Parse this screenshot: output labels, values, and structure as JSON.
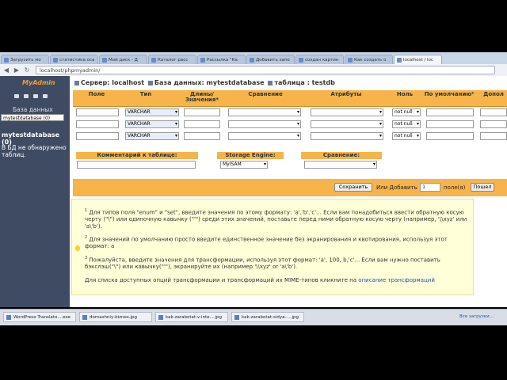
{
  "browser": {
    "tabs": [
      "Загрузить мо",
      "статистика оса",
      "Мой диск - Д",
      "Каталог расс",
      "Рассылка \"Ка",
      "Добавить запо",
      "создан картин",
      "Как создать о",
      "localhost / loc"
    ],
    "url": "localhost/phpmyadmin/"
  },
  "sidebar": {
    "logo": "MyAdmin",
    "db_label": "База данных",
    "db_select": "mytestdatabase (0)",
    "db_name": "mytestdatabase (0)",
    "no_tables": "В БД не обнаружено таблиц."
  },
  "breadcrumb": {
    "server": "Сервер: localhost",
    "database": "База данных: mytestdatabase",
    "table": "таблица : testdb"
  },
  "columns": {
    "field": "Поле",
    "type": "Тип",
    "length": "Длины/ Значения*",
    "collation": "Сравнение",
    "attributes": "Атрибуты",
    "null": "Ноль",
    "default": "По умолчанию²",
    "extra": "Допол"
  },
  "rows": [
    {
      "type": "VARCHAR",
      "null": "not null"
    },
    {
      "type": "VARCHAR",
      "null": "not null"
    },
    {
      "type": "VARCHAR",
      "null": "not null"
    }
  ],
  "table_options": {
    "comment_label": "Комментарий к таблице:",
    "engine_label": "Storage Engine:",
    "engine_value": "MyISAM",
    "collation_label": "Сравнение:"
  },
  "actions": {
    "save": "Сохранить",
    "or_add": "Или Добавить",
    "add_count": "1",
    "fields_label": "поле(я)",
    "go": "Пошел"
  },
  "info": {
    "n1": "1",
    "p1": "Для типов поля \"enum\" и \"set\", введите значения по этому формату: 'a','b','c'... Если вам понадобиться ввести обратную косую черту (\"\\\") или одиночную кавычку (\"'\") среди этих значений, поставьте перед ними обратную косую черту (например, '\\\\xyz' или 'a\\'b').",
    "n2": "2",
    "p2": "Для значений по умолчанию просто введите единственное значение без экранирования и квотирования, используя этот формат: a",
    "n3": "3",
    "p3": "Пожалуйста, введите значения для трансформации, используя этот формат: 'a', 100, b,'c'... Если вам нужно поставить бэкслэш(\"\\\") или кавычку(\"'\"), экранируйте их (например '\\\\xyz' or 'a\\'b').",
    "p4": "Для списка доступных опций трансформации и трансформаций их MIME-типов кликните на",
    "p4_link": "описание трансформаций"
  },
  "taskbar": {
    "items": [
      "WordPress Translato....exe",
      "domashniy-biznes.jpg",
      "kak-zarabotat-v-inte....jpg",
      "kak-zarabotat-sidya-....jpg"
    ],
    "right": "Все загрузки..."
  }
}
